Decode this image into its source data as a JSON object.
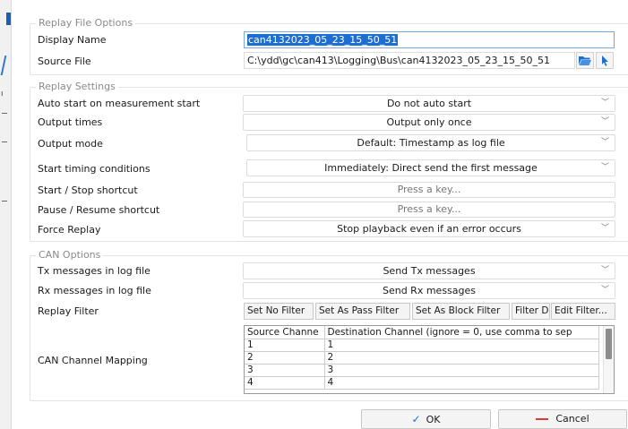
{
  "replay_file_options": {
    "legend": "Replay File Options",
    "display_name_label": "Display Name",
    "display_name_value": "can4132023_05_23_15_50_51",
    "source_file_label": "Source File",
    "source_file_value": "C:\\ydd\\gc\\can413\\Logging\\Bus\\can4132023_05_23_15_50_51"
  },
  "replay_settings": {
    "legend": "Replay Settings",
    "auto_start_label": "Auto start on measurement start",
    "auto_start_value": "Do not auto start",
    "output_times_label": "Output times",
    "output_times_value": "Output only once",
    "output_mode_label": "Output mode",
    "output_mode_value": "Default: Timestamp as log file",
    "start_timing_label": "Start timing conditions",
    "start_timing_value": "Immediately: Direct send the first message",
    "start_stop_label": "Start / Stop shortcut",
    "start_stop_value": "Press a key...",
    "pause_resume_label": "Pause / Resume shortcut",
    "pause_resume_value": "Press a key...",
    "force_replay_label": "Force Replay",
    "force_replay_value": "Stop playback even if an error occurs"
  },
  "can_options": {
    "legend": "CAN Options",
    "tx_label": "Tx messages in log file",
    "tx_value": "Send Tx messages",
    "rx_label": "Rx messages in log file",
    "rx_value": "Send Rx messages",
    "replay_filter_label": "Replay Filter",
    "filter_buttons": [
      "Set No Filter",
      "Set As Pass Filter",
      "Set As Block Filter",
      "Filter D",
      "Edit Filter..."
    ],
    "mapping_label": "CAN Channel Mapping",
    "mapping_headers": [
      "Source Channe",
      "Destination Channel (ignore = 0, use comma to sep"
    ],
    "mapping_rows": [
      [
        "1",
        "1"
      ],
      [
        "2",
        "2"
      ],
      [
        "3",
        "3"
      ],
      [
        "4",
        "4"
      ]
    ]
  },
  "buttons": {
    "ok": "OK",
    "cancel": "Cancel"
  },
  "left_strip": {
    "tick_glyph": "ı"
  },
  "colors": {
    "accent": "#1c6fd1",
    "cancel_red": "#d93a3a"
  },
  "icons": [
    "folder-open-icon",
    "cursor-select-icon",
    "chevron-down-icon",
    "checkmark-icon",
    "minus-icon"
  ]
}
